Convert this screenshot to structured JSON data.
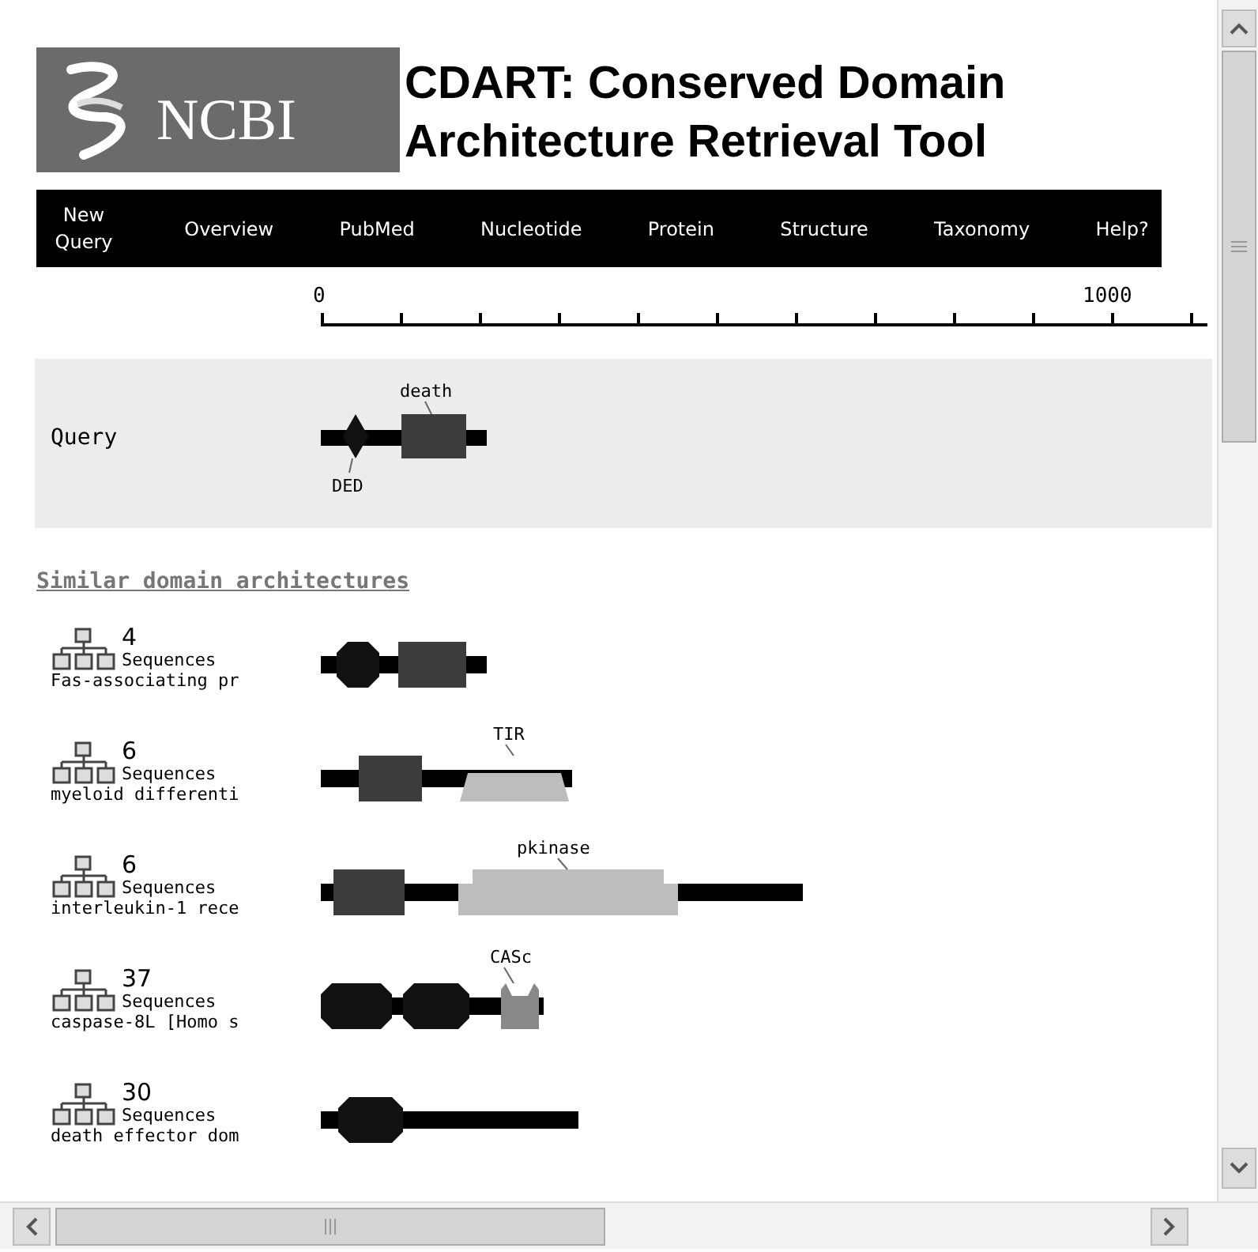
{
  "header": {
    "logo_text": "NCBI",
    "title_lines": [
      "CDART: Conserved Domain",
      "Architecture Retrieval Tool"
    ]
  },
  "nav": [
    {
      "label": "New Query"
    },
    {
      "label": "Overview"
    },
    {
      "label": "PubMed"
    },
    {
      "label": "Nucleotide"
    },
    {
      "label": "Protein"
    },
    {
      "label": "Structure"
    },
    {
      "label": "Taxonomy"
    },
    {
      "label": "Help?"
    }
  ],
  "ruler": {
    "start": "0",
    "end": "1000"
  },
  "query": {
    "label": "Query",
    "domain_labels": [
      "death",
      "DED"
    ]
  },
  "section_heading": "Similar domain architectures",
  "architectures": [
    {
      "count": "4",
      "unit": "Sequences",
      "description": "Fas-associating pr"
    },
    {
      "count": "6",
      "unit": "Sequences",
      "description": "myeloid differenti",
      "domain_labels": [
        "TIR"
      ]
    },
    {
      "count": "6",
      "unit": "Sequences",
      "description": "interleukin-1 rece",
      "domain_labels": [
        "pkinase"
      ]
    },
    {
      "count": "37",
      "unit": "Sequences",
      "description": "caspase-8L [Homo s",
      "domain_labels": [
        "CASc"
      ]
    },
    {
      "count": "30",
      "unit": "Sequences",
      "description": "death effector dom"
    }
  ]
}
